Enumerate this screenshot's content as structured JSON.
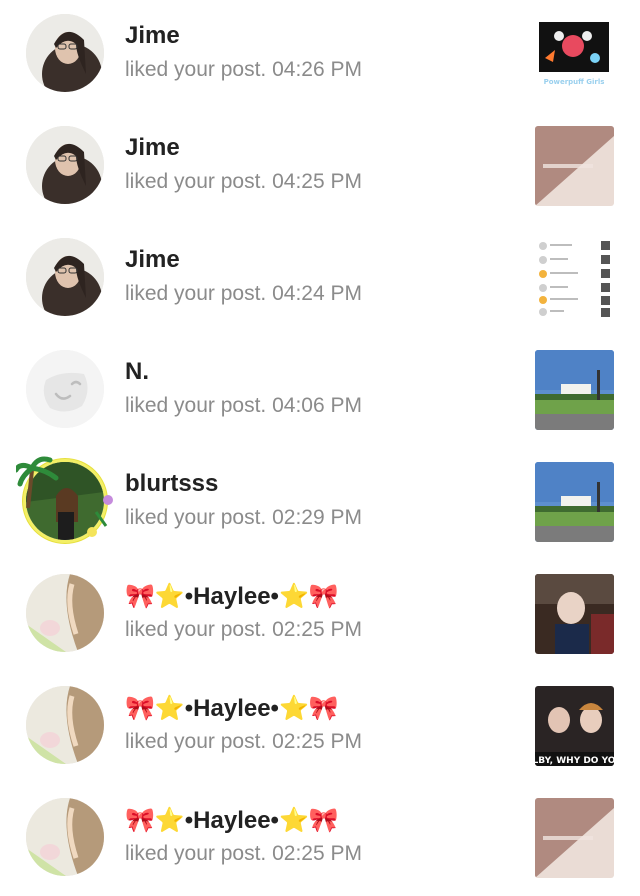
{
  "notifications": [
    {
      "user": "Jime",
      "action": "liked your post.",
      "time": "04:26 PM",
      "avatar": "woman-glasses-photo",
      "thumbnail": "powerpuff-girls-sticker"
    },
    {
      "user": "Jime",
      "action": "liked your post.",
      "time": "04:25 PM",
      "avatar": "woman-glasses-photo",
      "thumbnail": "pink-diagonal-text-post"
    },
    {
      "user": "Jime",
      "action": "liked your post.",
      "time": "04:24 PM",
      "avatar": "woman-glasses-photo",
      "thumbnail": "notification-list-screenshot"
    },
    {
      "user": "N.",
      "action": "liked your post.",
      "time": "04:06 PM",
      "avatar": "default-face-icon",
      "thumbnail": "white-building-sky"
    },
    {
      "user": "blurtsss",
      "action": "liked your post.",
      "time": "02:29 PM",
      "avatar": "woman-palm-tree-frame",
      "thumbnail": "white-building-sky"
    },
    {
      "user": "•Haylee•",
      "user_emoji_left": "🎀⭐",
      "user_emoji_right": "⭐🎀",
      "action": "liked your post.",
      "time": "02:25 PM",
      "avatar": "braided-hair-photo",
      "thumbnail": "people-selfie-photo"
    },
    {
      "user": "•Haylee•",
      "user_emoji_left": "🎀⭐",
      "user_emoji_right": "⭐🎀",
      "action": "liked your post.",
      "time": "02:25 PM",
      "avatar": "braided-hair-photo",
      "thumbnail": "two-men-caption-photo"
    },
    {
      "user": "•Haylee•",
      "user_emoji_left": "🎀⭐",
      "user_emoji_right": "⭐🎀",
      "action": "liked your post.",
      "time": "02:25 PM",
      "avatar": "braided-hair-photo",
      "thumbnail": "pink-diagonal-text-post"
    }
  ],
  "thumbnail_captions": {
    "powerpuff": "Powerpuff Girls",
    "caption_strip": "LBY, WHY DO YO"
  }
}
